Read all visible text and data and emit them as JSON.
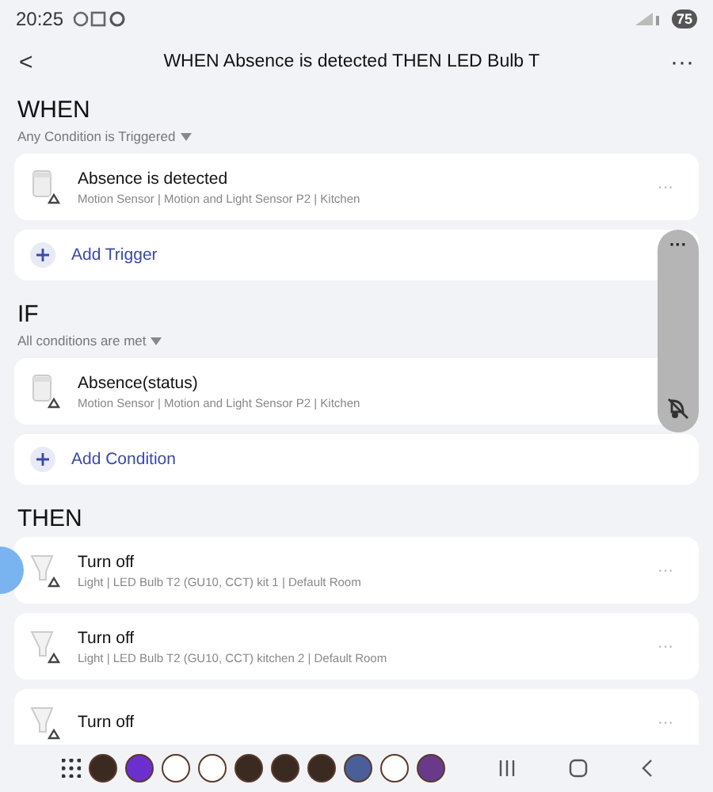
{
  "status_bar": {
    "time": "20:25",
    "battery": "75"
  },
  "header": {
    "back": "<",
    "title": "WHEN Absence is detected THEN LED Bulb T",
    "menu": "···"
  },
  "sections": [
    {
      "title": "WHEN",
      "mode": "Any Condition is Triggered",
      "items": [
        {
          "kind": "sensor",
          "title": "Absence is detected",
          "subtitle": "Motion Sensor | Motion and Light Sensor P2 | Kitchen"
        }
      ],
      "add": "Add Trigger"
    },
    {
      "title": "IF",
      "mode": "All conditions are met",
      "items": [
        {
          "kind": "sensor",
          "title": "Absence(status)",
          "subtitle": "Motion Sensor | Motion and Light Sensor P2 | Kitchen"
        }
      ],
      "add": "Add Condition"
    },
    {
      "title": "THEN",
      "items": [
        {
          "kind": "bulb",
          "title": "Turn off",
          "subtitle": "Light | LED Bulb T2 (GU10, CCT) kit 1 | Default Room"
        },
        {
          "kind": "bulb",
          "title": "Turn off",
          "subtitle": "Light | LED Bulb T2 (GU10, CCT) kitchen 2 | Default Room"
        },
        {
          "kind": "bulb",
          "title": "Turn off"
        }
      ]
    }
  ],
  "item_menu": "···",
  "floating_panel": {
    "menu": "···"
  }
}
